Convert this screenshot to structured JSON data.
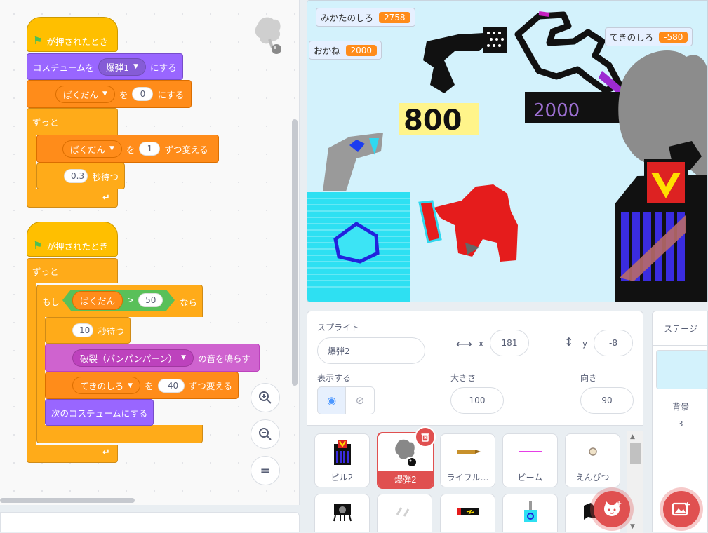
{
  "scripts": {
    "script1": {
      "hat": "が押されたとき",
      "costume_prefix": "コスチュームを",
      "costume_value": "爆弾1",
      "costume_suffix": "にする",
      "setvar_value": "ばくだん",
      "setvar_mid": "を",
      "setvar_num": "0",
      "setvar_suffix": "にする",
      "forever": "ずっと",
      "change_var": "ばくだん",
      "change_mid": "を",
      "change_num": "1",
      "change_suffix": "ずつ変える",
      "wait_num": "0.3",
      "wait_suffix": "秒待つ"
    },
    "script2": {
      "hat": "が押されたとき",
      "forever": "ずっと",
      "if_prefix": "もし",
      "cond_var": "ばくだん",
      "cond_op": ">",
      "cond_num": "50",
      "if_suffix": "なら",
      "wait_num": "10",
      "wait_suffix": "秒待つ",
      "sound_value": "破裂（パンパンパーン）",
      "sound_suffix": "の音を鳴らす",
      "change_var": "てきのしろ",
      "change_mid": "を",
      "change_num": "-40",
      "change_suffix": "ずつ変える",
      "next_costume": "次のコスチュームにする"
    }
  },
  "zoom": {
    "in": "zoom-in-icon",
    "out": "zoom-out-icon",
    "reset": "="
  },
  "stage": {
    "monitors": [
      {
        "label": "みかたのしろ",
        "value": "2758"
      },
      {
        "label": "おかね",
        "value": "2000"
      },
      {
        "label": "てきのしろ",
        "value": "-580"
      }
    ],
    "drawn_text": {
      "left": "800",
      "right": "2000"
    }
  },
  "sprite_info": {
    "sprite_label": "スプライト",
    "sprite_name": "爆弾2",
    "x_label": "x",
    "x_value": "181",
    "y_label": "y",
    "y_value": "-8",
    "show_label": "表示する",
    "size_label": "大きさ",
    "size_value": "100",
    "direction_label": "向き",
    "direction_value": "90"
  },
  "sprites": [
    {
      "name": "ビル2"
    },
    {
      "name": "爆弾2"
    },
    {
      "name": "ライフル…"
    },
    {
      "name": "ビーム"
    },
    {
      "name": "えんぴつ"
    }
  ],
  "stage_panel": {
    "title": "ステージ",
    "backdrop_label": "背景",
    "backdrop_count": "3"
  },
  "colors": {
    "accent": "#ff8c1a",
    "selected": "#e05050",
    "stage_bg": "#d3f2fc"
  }
}
